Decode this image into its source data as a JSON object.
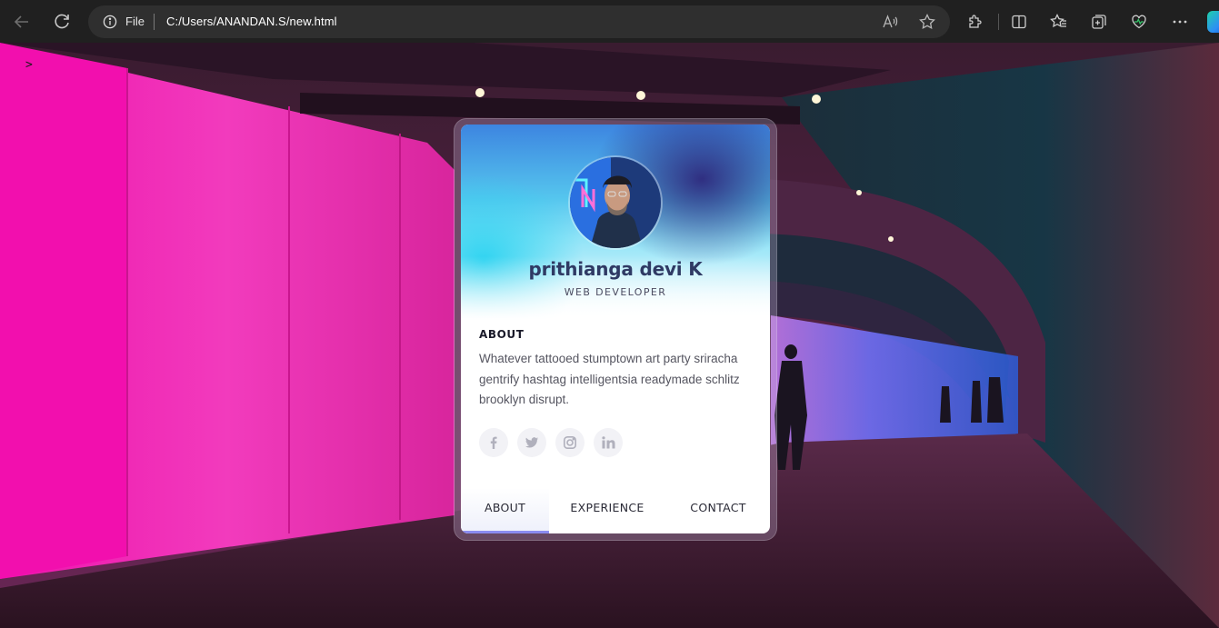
{
  "browser": {
    "scheme_label": "File",
    "url": "C:/Users/ANANDAN.S/new.html",
    "icons": [
      "back-icon",
      "reload-icon",
      "info-icon",
      "read-aloud-icon",
      "add-favorite-icon",
      "extensions-icon",
      "split-screen-icon",
      "favorites-icon",
      "collections-icon",
      "browser-essentials-icon",
      "more-icon",
      "edge-logo-icon"
    ]
  },
  "page": {
    "marker": ">"
  },
  "profile": {
    "name": "prithianga devi K",
    "role": "WEB DEVELOPER",
    "about_heading": "ABOUT",
    "about_text": "Whatever tattooed stumptown art party sriracha gentrify hashtag intelligentsia readymade schlitz brooklyn disrupt.",
    "socials": [
      "facebook-icon",
      "twitter-icon",
      "instagram-icon",
      "linkedin-icon"
    ]
  },
  "tabs": [
    {
      "label": "ABOUT",
      "active": true
    },
    {
      "label": "EXPERIENCE",
      "active": false
    },
    {
      "label": "CONTACT",
      "active": false
    }
  ],
  "colors": {
    "tab_active_underline": "#8a8cf0",
    "name_color": "#2f3a64",
    "wall_pink": "#f01bb0"
  }
}
